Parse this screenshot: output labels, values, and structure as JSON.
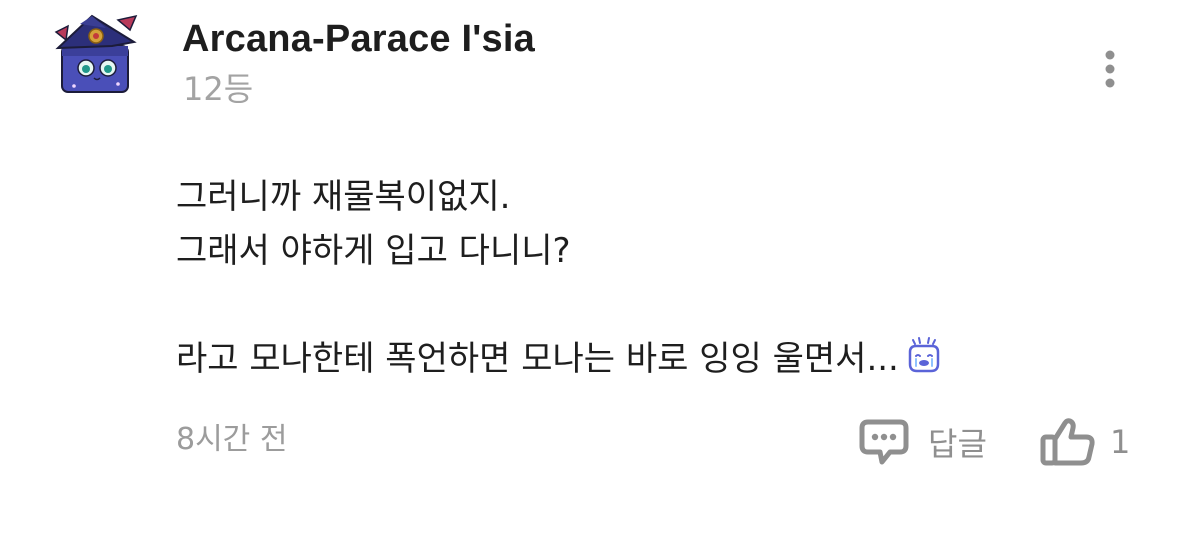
{
  "comment": {
    "author": "Arcana-Parace I'sia",
    "rank": "12등",
    "lines": [
      "그러니까 재물복이없지.",
      "그래서 야하게 입고 다니니?",
      "",
      "라고 모나한테 폭언하면 모나는 바로 잉잉 울면서..."
    ],
    "time_ago": "8시간 전"
  },
  "actions": {
    "reply_label": "답글",
    "like_count": "1"
  },
  "icons": {
    "more": "more-vertical-icon",
    "reply": "speech-bubble-icon",
    "like": "thumbs-up-icon",
    "emoji": "crying-face-emoji"
  },
  "colors": {
    "text": "#1e1e1e",
    "muted": "#a3a3a3",
    "icon": "#8f8f8f",
    "emoji": "#5a63d8"
  }
}
